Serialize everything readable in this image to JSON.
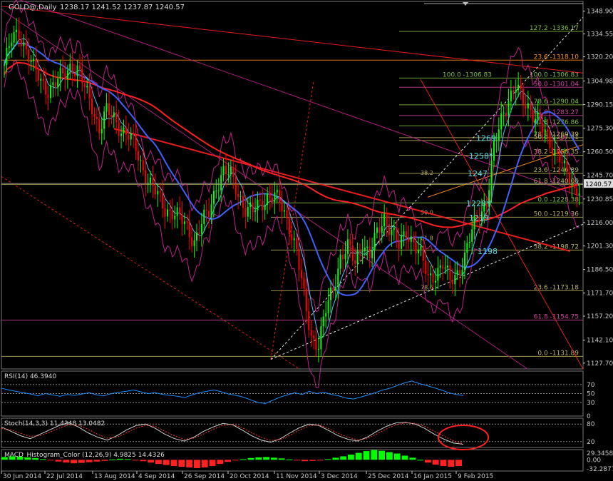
{
  "header": {
    "symbol": "GOLD@,Daily",
    "ohlc": "1238.17 1241.52 1237.87 1240.57"
  },
  "colors": {
    "background": "#000000",
    "axis": "#c8c8c8",
    "grid": "#3a3a3a",
    "bull_candle": "#00ff00",
    "bear_candle": "#ff0000",
    "ma_red": "#ff2020",
    "ma_blue": "#4060ff",
    "bollinger": "#c0208a",
    "trendline": "#ff2020",
    "fib_green": "#7fbf3f",
    "fib_pink": "#d040a0",
    "fib_orange": "#ff8c1a",
    "projection": "#ffffff",
    "annotation": "#55ddee",
    "rsi_line": "#1e90ff",
    "stoch_main": "#cfcfcf",
    "stoch_signal": "#ff3030",
    "macd_pos": "#00ff00",
    "macd_neg": "#ff2020",
    "circle": "#ff2020"
  },
  "chart_data": [
    {
      "type": "candlestick",
      "title": "GOLD@,Daily",
      "ylim": [
        1124,
        1355
      ],
      "price_ticks": [
        "1348.90",
        "1334.55",
        "1320.20",
        "1304.98",
        "1290.15",
        "1275.30",
        "1260.50",
        "1245.70",
        "1230.85",
        "1216.00",
        "1201.30",
        "1186.50",
        "1171.70",
        "1157.20",
        "1142.10",
        "1127.70"
      ],
      "current_price": "1240.57",
      "date_labels": [
        "30 Jun 2014",
        "22 Jul 2014",
        "13 Aug 2014",
        "4 Sep 2014",
        "26 Sep 2014",
        "20 Oct 2014",
        "11 Nov 2014",
        "3 Dec 2014",
        "25 Dec 2014",
        "16 Jan 2015",
        "9 Feb 2015"
      ],
      "close_path": [
        [
          0,
          1315
        ],
        [
          3,
          1330
        ],
        [
          6,
          1336
        ],
        [
          9,
          1325
        ],
        [
          12,
          1312
        ],
        [
          15,
          1305
        ],
        [
          18,
          1300
        ],
        [
          21,
          1303
        ],
        [
          24,
          1308
        ],
        [
          27,
          1315
        ],
        [
          30,
          1312
        ],
        [
          33,
          1300
        ],
        [
          36,
          1290
        ],
        [
          39,
          1275
        ],
        [
          42,
          1285
        ],
        [
          45,
          1282
        ],
        [
          48,
          1275
        ],
        [
          51,
          1270
        ],
        [
          54,
          1262
        ],
        [
          57,
          1250
        ],
        [
          60,
          1240
        ],
        [
          63,
          1232
        ],
        [
          66,
          1225
        ],
        [
          69,
          1223
        ],
        [
          72,
          1218
        ],
        [
          75,
          1213
        ],
        [
          78,
          1205
        ],
        [
          81,
          1215
        ],
        [
          84,
          1222
        ],
        [
          87,
          1240
        ],
        [
          90,
          1248
        ],
        [
          93,
          1245
        ],
        [
          96,
          1235
        ],
        [
          99,
          1225
        ],
        [
          102,
          1222
        ],
        [
          105,
          1228
        ],
        [
          108,
          1233
        ],
        [
          111,
          1232
        ],
        [
          114,
          1225
        ],
        [
          117,
          1215
        ],
        [
          120,
          1198
        ],
        [
          123,
          1168
        ],
        [
          126,
          1145
        ],
        [
          129,
          1140
        ],
        [
          132,
          1160
        ],
        [
          135,
          1175
        ],
        [
          138,
          1195
        ],
        [
          141,
          1200
        ],
        [
          144,
          1190
        ],
        [
          147,
          1205
        ],
        [
          150,
          1195
        ],
        [
          153,
          1208
        ],
        [
          156,
          1220
        ],
        [
          159,
          1212
        ],
        [
          162,
          1200
        ],
        [
          165,
          1210
        ],
        [
          168,
          1205
        ],
        [
          171,
          1195
        ],
        [
          174,
          1180
        ],
        [
          177,
          1185
        ],
        [
          180,
          1190
        ],
        [
          183,
          1178
        ],
        [
          186,
          1185
        ],
        [
          189,
          1195
        ],
        [
          192,
          1210
        ],
        [
          195,
          1222
        ],
        [
          198,
          1230
        ],
        [
          201,
          1262
        ],
        [
          204,
          1280
        ],
        [
          207,
          1295
        ],
        [
          210,
          1302
        ],
        [
          213,
          1290
        ],
        [
          216,
          1288
        ],
        [
          219,
          1282
        ],
        [
          222,
          1270
        ],
        [
          225,
          1262
        ],
        [
          228,
          1260
        ],
        [
          231,
          1245
        ],
        [
          234,
          1233
        ],
        [
          236,
          1240
        ]
      ],
      "fib_levels_right": [
        {
          "label": "127.2 -1336.17",
          "value": 1336.17
        },
        {
          "label": "23.6 -1318.10",
          "value": 1318.1
        },
        {
          "label": "100.0 -1306.83",
          "value": 1306.83
        },
        {
          "label": "100.0 -1306.83",
          "value": 1306.83
        },
        {
          "label": "50.0 -1301.04",
          "value": 1301.04
        },
        {
          "label": "78.6 -1290.04",
          "value": 1290.04
        },
        {
          "label": "61.8 -1283.27",
          "value": 1283.27
        },
        {
          "label": "61.8 -1276.86",
          "value": 1276.86
        },
        {
          "label": "78.6 -1269.39",
          "value": 1269.39
        },
        {
          "label": "50.0 -1267.61",
          "value": 1267.61
        },
        {
          "label": "38.2 -1258.35",
          "value": 1258.35
        },
        {
          "label": "23.6 -1246.89",
          "value": 1246.89
        },
        {
          "label": "61.8 -1240.00",
          "value": 1240.0
        },
        {
          "label": "0.0 -1228.38",
          "value": 1228.38
        },
        {
          "label": "50.0 -1219.36",
          "value": 1219.36
        },
        {
          "label": "38.2 -1198.72",
          "value": 1198.72
        },
        {
          "label": "23.6 -1173.18",
          "value": 1173.18
        },
        {
          "label": "61.8 -1154.75",
          "value": 1154.75
        },
        {
          "label": "0.0 -1131.89",
          "value": 1131.89
        }
      ],
      "fib_inner_labels": [
        "38.2",
        "50.0",
        "61.8",
        "78.6"
      ],
      "annotations": [
        {
          "text": "1269",
          "value": 1269
        },
        {
          "text": "1258*",
          "value": 1258
        },
        {
          "text": "1247",
          "value": 1247
        },
        {
          "text": "1228*",
          "value": 1228
        },
        {
          "text": "1219",
          "value": 1219
        },
        {
          "text": "1198",
          "value": 1198
        }
      ]
    },
    {
      "type": "line",
      "title": "RSI(14) 46.3940",
      "ylim": [
        0,
        100
      ],
      "ticks": [
        "70",
        "50",
        "30",
        "0"
      ],
      "levels": [
        70,
        50,
        30
      ],
      "values": [
        62,
        58,
        55,
        52,
        49,
        45,
        50,
        47,
        44,
        48,
        46,
        49,
        52,
        47,
        45,
        50,
        53,
        55,
        58,
        54,
        50,
        52,
        48,
        46,
        44,
        41,
        47,
        52,
        55,
        58,
        54,
        49,
        46,
        42,
        36,
        30,
        28,
        35,
        42,
        47,
        52,
        48,
        55,
        50,
        53,
        48,
        45,
        40,
        38,
        42,
        47,
        52,
        58,
        62,
        68,
        74,
        78,
        72,
        68,
        63,
        58,
        52,
        48,
        46
      ]
    },
    {
      "type": "line",
      "title": "Stoch(14,3,3) 11.4348 13.0482",
      "ylim": [
        0,
        100
      ],
      "ticks": [
        "80",
        "20"
      ],
      "levels": [
        80,
        20
      ],
      "series": [
        {
          "values": [
            70,
            55,
            40,
            30,
            45,
            60,
            75,
            85,
            70,
            50,
            35,
            25,
            40,
            60,
            75,
            80,
            65,
            45,
            30,
            22,
            35,
            55,
            70,
            82,
            78,
            60,
            40,
            25,
            18,
            30,
            50,
            68,
            80,
            75,
            58,
            40,
            28,
            22,
            35,
            55,
            72,
            84,
            86,
            80,
            65,
            45,
            28,
            15,
            11
          ]
        },
        {
          "values": [
            65,
            60,
            48,
            38,
            40,
            52,
            66,
            78,
            76,
            62,
            45,
            32,
            35,
            50,
            66,
            76,
            72,
            55,
            40,
            28,
            32,
            46,
            62,
            75,
            79,
            68,
            50,
            35,
            24,
            27,
            42,
            60,
            74,
            77,
            65,
            48,
            35,
            26,
            30,
            46,
            63,
            78,
            84,
            82,
            72,
            55,
            38,
            22,
            13
          ]
        }
      ]
    },
    {
      "type": "bar",
      "title": "MACD_Histogram_Color (12,26,9) 4.9825 14.4326",
      "ylim": [
        -32.2877,
        29.3458
      ],
      "ticks": [
        "29.3458",
        "0.00",
        "-32.2877"
      ],
      "values": [
        8,
        10,
        9,
        7,
        5,
        2,
        -2,
        -5,
        -8,
        -10,
        -9,
        -7,
        -5,
        -3,
        1,
        3,
        2,
        -1,
        -4,
        -8,
        -12,
        -15,
        -18,
        -20,
        -22,
        -24,
        -22,
        -18,
        -12,
        -6,
        -2,
        2,
        5,
        7,
        8,
        6,
        4,
        1,
        -2,
        -4,
        -3,
        -1,
        2,
        6,
        10,
        15,
        20,
        25,
        28,
        26,
        22,
        18,
        12,
        6,
        0,
        -8,
        -14,
        -18,
        -20,
        -18
      ]
    }
  ],
  "chart_type": "financial candlestick",
  "y_scale": "linear",
  "grid": "off"
}
